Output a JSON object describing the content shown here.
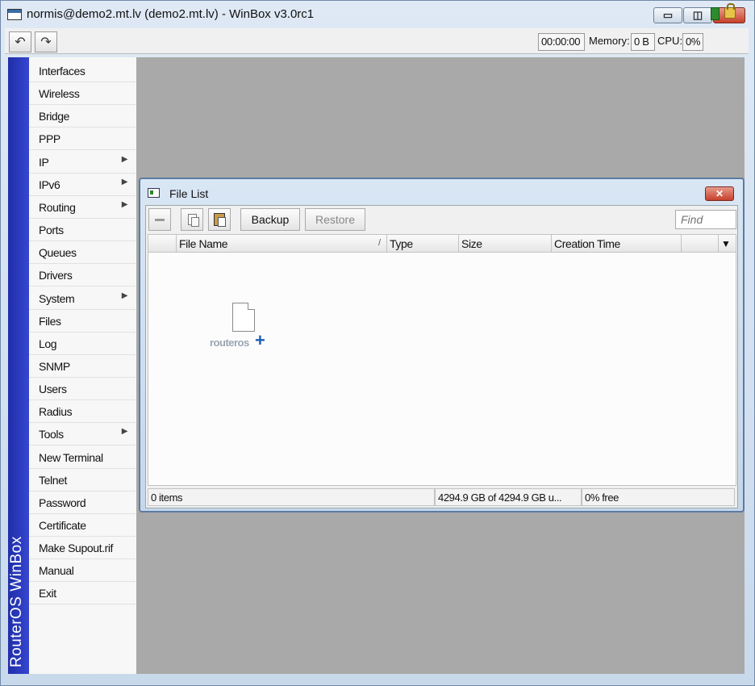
{
  "window": {
    "title": "normis@demo2.mt.lv (demo2.mt.lv) - WinBox v3.0rc1",
    "minimize": "▭",
    "maximize": "◫",
    "close": "✕"
  },
  "toolbar": {
    "undo_icon": "↶",
    "redo_icon": "↷",
    "uptime": "00:00:00",
    "memory_label": "Memory:",
    "memory_value": "0 B",
    "cpu_label": "CPU:",
    "cpu_value": "0%"
  },
  "sidebar": {
    "banner": "RouterOS WinBox",
    "submenu_glyph": "▶",
    "items": [
      {
        "label": "Interfaces",
        "submenu": false
      },
      {
        "label": "Wireless",
        "submenu": false
      },
      {
        "label": "Bridge",
        "submenu": false
      },
      {
        "label": "PPP",
        "submenu": false
      },
      {
        "label": "IP",
        "submenu": true
      },
      {
        "label": "IPv6",
        "submenu": true
      },
      {
        "label": "Routing",
        "submenu": true
      },
      {
        "label": "Ports",
        "submenu": false
      },
      {
        "label": "Queues",
        "submenu": false
      },
      {
        "label": "Drivers",
        "submenu": false
      },
      {
        "label": "System",
        "submenu": true
      },
      {
        "label": "Files",
        "submenu": false
      },
      {
        "label": "Log",
        "submenu": false
      },
      {
        "label": "SNMP",
        "submenu": false
      },
      {
        "label": "Users",
        "submenu": false
      },
      {
        "label": "Radius",
        "submenu": false
      },
      {
        "label": "Tools",
        "submenu": true
      },
      {
        "label": "New Terminal",
        "submenu": false
      },
      {
        "label": "Telnet",
        "submenu": false
      },
      {
        "label": "Password",
        "submenu": false
      },
      {
        "label": "Certificate",
        "submenu": false
      },
      {
        "label": "Make Supout.rif",
        "submenu": false
      },
      {
        "label": "Manual",
        "submenu": false
      },
      {
        "label": "Exit",
        "submenu": false
      }
    ]
  },
  "file_list": {
    "title": "File List",
    "close": "✕",
    "backup_label": "Backup",
    "restore_label": "Restore",
    "find_placeholder": "Find",
    "columns": [
      "File Name",
      "Type",
      "Size",
      "Creation Time"
    ],
    "sort_indicator": "/",
    "column_menu": "▼",
    "empty_logo_text": "routeros",
    "empty_logo_plus": "+",
    "status": {
      "items": "0 items",
      "space": "4294.9 GB of 4294.9 GB u...",
      "free": "0% free"
    }
  }
}
